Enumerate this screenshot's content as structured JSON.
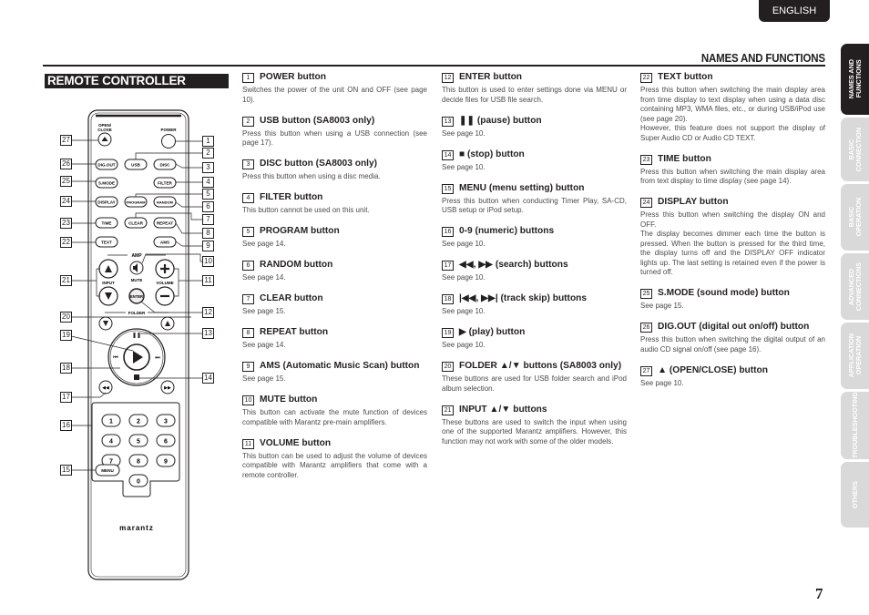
{
  "header": {
    "language_tab": "ENGLISH",
    "section_title": "NAMES AND FUNCTIONS",
    "subsection_title": "REMOTE CONTROLLER"
  },
  "side_tabs": [
    {
      "label": "NAMES AND\nFUNCTIONS",
      "active": true
    },
    {
      "label": "BASIC\nCONNECTION",
      "active": false
    },
    {
      "label": "BASIC\nOPERATION",
      "active": false
    },
    {
      "label": "ADVANCED\nCONNECTIONS",
      "active": false
    },
    {
      "label": "APPLICATION\nOPERATION",
      "active": false
    },
    {
      "label": "TROUBLESHOOTING",
      "active": false
    },
    {
      "label": "OTHERS",
      "active": false
    }
  ],
  "remote": {
    "brand": "marantz",
    "labels": {
      "open_close": "OPEN/\nCLOSE",
      "power": "POWER",
      "dig_out": "DIG.OUT",
      "usb": "USB",
      "disc": "DISC",
      "s_mode": "S.MODE",
      "filter": "FILTER",
      "display": "DISPLAY",
      "program": "PROGRAM",
      "random": "RANDOM",
      "time": "TIME",
      "clear": "CLEAR",
      "repeat": "REPEAT",
      "text": "TEXT",
      "ams": "AMS",
      "amp": "AMP",
      "input": "INPUT",
      "mute": "MUTE",
      "volume": "VOLUME",
      "enter": "ENTER",
      "folder": "FOLDER",
      "menu": "MENU"
    },
    "numeric_keys": [
      "1",
      "2",
      "3",
      "4",
      "5",
      "6",
      "7",
      "8",
      "9",
      "0"
    ],
    "callouts_left": [
      "27",
      "26",
      "25",
      "24",
      "23",
      "22",
      "21",
      "20",
      "19",
      "18",
      "17",
      "16",
      "15"
    ],
    "callouts_right": [
      "1",
      "2",
      "3",
      "4",
      "5",
      "6",
      "7",
      "8",
      "9",
      "10",
      "11",
      "12",
      "13",
      "14"
    ]
  },
  "columns": [
    [
      {
        "num": "1",
        "title": "POWER button",
        "desc": "Switches the power of the unit ON and OFF (see page 10)."
      },
      {
        "num": "2",
        "title": "USB button (SA8003 only)",
        "desc": "Press this button when using a USB connection (see page 17)."
      },
      {
        "num": "3",
        "title": "DISC button (SA8003 only)",
        "desc": "Press this button when using a disc media."
      },
      {
        "num": "4",
        "title": "FILTER button",
        "desc": "This button cannot be used on this unit."
      },
      {
        "num": "5",
        "title": "PROGRAM button",
        "desc": "See page 14."
      },
      {
        "num": "6",
        "title": "RANDOM button",
        "desc": "See page 14."
      },
      {
        "num": "7",
        "title": "CLEAR button",
        "desc": "See page 15."
      },
      {
        "num": "8",
        "title": "REPEAT button",
        "desc": "See page 14."
      },
      {
        "num": "9",
        "title": "AMS (Automatic Music Scan) button",
        "desc": "See page 15."
      },
      {
        "num": "10",
        "title": "MUTE button",
        "desc": "This button can activate the mute function of devices compatible with Marantz pre-main amplifiers."
      },
      {
        "num": "11",
        "title": "VOLUME button",
        "desc": "This button can be used to adjust the volume of devices compatible with Marantz amplifiers that come with a remote controller."
      }
    ],
    [
      {
        "num": "12",
        "title": "ENTER button",
        "desc": "This button is used to enter settings done via MENU or decide files for USB file search."
      },
      {
        "num": "13",
        "title": "❚❚ (pause) button",
        "desc": "See page 10."
      },
      {
        "num": "14",
        "title": "■ (stop) button",
        "desc": "See page 10."
      },
      {
        "num": "15",
        "title": "MENU (menu setting) button",
        "desc": "Press this button when conducting Timer Play, SA-CD, USB setup or iPod setup."
      },
      {
        "num": "16",
        "title": "0-9 (numeric) buttons",
        "desc": "See page 10."
      },
      {
        "num": "17",
        "title": "◀◀, ▶▶ (search) buttons",
        "desc": "See page 10."
      },
      {
        "num": "18",
        "title": "|◀◀, ▶▶| (track skip) buttons",
        "desc": "See page 10."
      },
      {
        "num": "19",
        "title": "▶ (play) button",
        "desc": "See page 10."
      },
      {
        "num": "20",
        "title": "FOLDER ▲/▼ buttons (SA8003 only)",
        "desc": "These buttons are used for USB folder search and iPod album selection."
      },
      {
        "num": "21",
        "title": "INPUT ▲/▼ buttons",
        "desc": "These buttons are used to switch the input when using one of the supported Marantz amplifiers. However, this function may not work with some of the older models."
      }
    ],
    [
      {
        "num": "22",
        "title": "TEXT button",
        "desc": "Press this button when switching the main display area from time display to text display when using a data disc containing MP3, WMA files, etc., or during USB/iPod use (see page 20).\nHowever, this feature does not support the display of Super Audio CD or Audio CD TEXT."
      },
      {
        "num": "23",
        "title": "TIME button",
        "desc": "Press this button when switching the main display area from text display to time display (see page 14)."
      },
      {
        "num": "24",
        "title": "DISPLAY button",
        "desc": "Press this button when switching the display ON and OFF.\nThe display becomes dimmer each time the button is pressed. When the button is pressed for the third time, the display turns off and the DISPLAY OFF indicator lights up. The last setting is retained even if the power is turned off."
      },
      {
        "num": "25",
        "title": "S.MODE (sound mode) button",
        "desc": "See page 15."
      },
      {
        "num": "26",
        "title": "DIG.OUT (digital out on/off) button",
        "desc": "Press this button when switching the digital output of an audio CD signal on/off (see page 16)."
      },
      {
        "num": "27",
        "title": "▲ (OPEN/CLOSE) button",
        "desc": "See page 10."
      }
    ]
  ],
  "page_number": "7"
}
